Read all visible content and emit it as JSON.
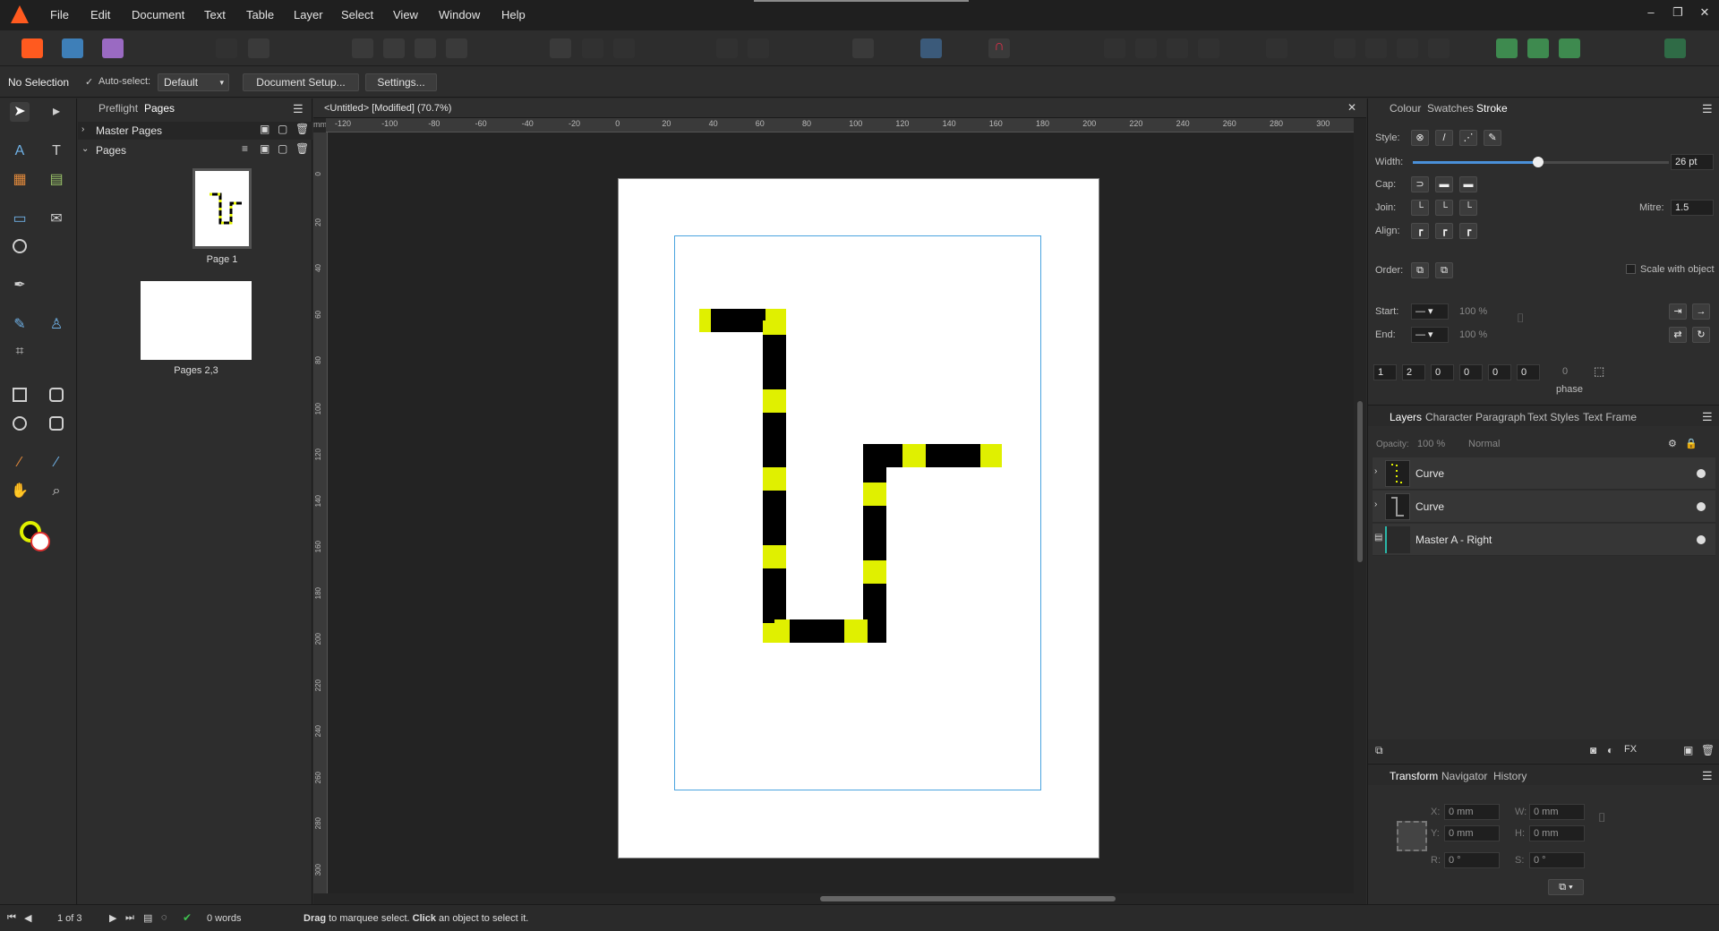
{
  "menubar": {
    "items": [
      "File",
      "Edit",
      "Document",
      "Text",
      "Table",
      "Layer",
      "Select",
      "View",
      "Window",
      "Help"
    ],
    "accent": "#ff5a1f"
  },
  "context": {
    "selection": "No Selection",
    "autoselect_label": "Auto-select:",
    "autoselect_value": "Default",
    "doc_setup": "Document Setup...",
    "settings": "Settings..."
  },
  "pages_panel": {
    "tabs": [
      "Preflight",
      "Pages"
    ],
    "master_pages": "Master Pages",
    "pages": "Pages",
    "thumb1_label": "Page 1",
    "thumb2_label": "Pages 2,3"
  },
  "document": {
    "tab_title": "<Untitled> [Modified] (70.7%)",
    "ruler_unit": "mm",
    "ruler_top": [
      "-120",
      "-100",
      "-80",
      "-60",
      "-40",
      "-20",
      "0",
      "20",
      "40",
      "60",
      "80",
      "100",
      "120",
      "140",
      "160",
      "180",
      "200",
      "220",
      "240",
      "260",
      "280",
      "300"
    ],
    "ruler_left": [
      "0",
      "20",
      "40",
      "60",
      "80",
      "100",
      "120",
      "140",
      "160",
      "180",
      "200",
      "220",
      "240",
      "260",
      "280",
      "300"
    ],
    "shape_colors": {
      "dash_a": "#000000",
      "dash_b": "#e0f000"
    }
  },
  "stroke_panel": {
    "tabs": [
      "Colour",
      "Swatches",
      "Stroke"
    ],
    "style_label": "Style:",
    "width_label": "Width:",
    "width_value": "26 pt",
    "width_fraction": 0.49,
    "cap_label": "Cap:",
    "join_label": "Join:",
    "mitre_label": "Mitre:",
    "mitre_value": "1.5",
    "align_label": "Align:",
    "order_label": "Order:",
    "scale_label": "Scale with object",
    "start_label": "Start:",
    "end_label": "End:",
    "start_pct": "100 %",
    "end_pct": "100 %",
    "dash_values": [
      "1",
      "2",
      "0",
      "0",
      "0",
      "0"
    ],
    "phase_value": "0",
    "phase_label": "phase"
  },
  "layers_panel": {
    "tabs": [
      "Layers",
      "Character",
      "Paragraph",
      "Text Styles",
      "Text Frame"
    ],
    "opacity_label": "Opacity:",
    "opacity_value": "100 %",
    "blend_value": "Normal",
    "layers": [
      {
        "name": "Curve"
      },
      {
        "name": "Curve"
      },
      {
        "name": "Master A - Right"
      }
    ]
  },
  "transform_panel": {
    "tabs": [
      "Transform",
      "Navigator",
      "History"
    ],
    "x_label": "X:",
    "x_value": "0 mm",
    "y_label": "Y:",
    "y_value": "0 mm",
    "w_label": "W:",
    "w_value": "0 mm",
    "h_label": "H:",
    "h_value": "0 mm",
    "r_label": "R:",
    "r_value": "0 °",
    "s_label": "S:",
    "s_value": "0 °"
  },
  "status": {
    "page_count": "1 of 3",
    "words": "0 words",
    "hint_drag": "Drag",
    "hint_mid": " to marquee select. ",
    "hint_click": "Click",
    "hint_end": " an object to select it."
  }
}
